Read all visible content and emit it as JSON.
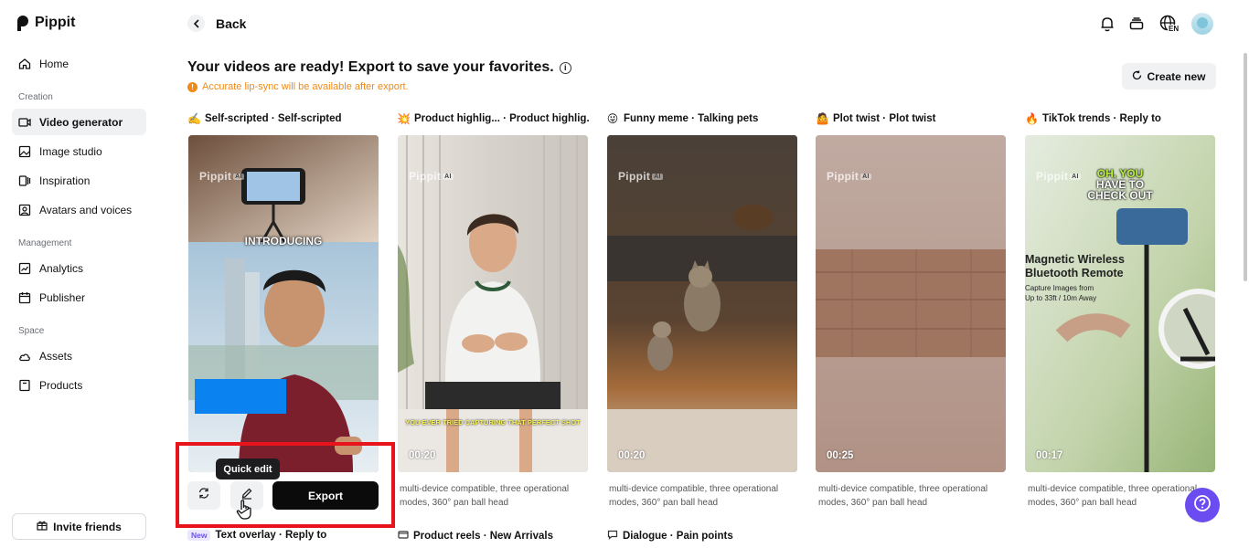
{
  "app": {
    "name": "Pippit"
  },
  "sidebar": {
    "home": "Home",
    "sections": [
      "Creation",
      "Management",
      "Space"
    ],
    "creation_items": [
      {
        "label": "Video generator",
        "icon": "video-generator-icon",
        "active": true
      },
      {
        "label": "Image studio",
        "icon": "image-studio-icon"
      },
      {
        "label": "Inspiration",
        "icon": "inspiration-icon"
      },
      {
        "label": "Avatars and voices",
        "icon": "avatar-voice-icon"
      }
    ],
    "management_items": [
      {
        "label": "Analytics",
        "icon": "analytics-icon"
      },
      {
        "label": "Publisher",
        "icon": "calendar-icon"
      }
    ],
    "space_items": [
      {
        "label": "Assets",
        "icon": "cloud-icon"
      },
      {
        "label": "Products",
        "icon": "product-box-icon"
      }
    ],
    "invite": "Invite friends"
  },
  "header": {
    "back": "Back",
    "language": "EN"
  },
  "main": {
    "headline": "Your videos are ready! Export to save your favorites.",
    "warning": "Accurate lip-sync will be available after export.",
    "create_new": "Create new",
    "cards": [
      {
        "emoji": "✍️",
        "title": "Self-scripted · Self-scripted",
        "watermark": "Pippit",
        "overlay": "INTRODUCING"
      },
      {
        "emoji": "💥",
        "title": "Product highlig... · Product highlig...",
        "watermark": "Pippit",
        "duration": "00:20",
        "subtitle": "YOU EVER TRIED CAPTURING THAT PERFECT SHOT",
        "desc": "multi-device compatible, three operational modes, 360° pan ball head"
      },
      {
        "emoji": "😜",
        "title": "Funny meme · Talking pets",
        "watermark": "Pippit",
        "duration": "00:20",
        "desc": "multi-device compatible, three operational modes, 360° pan ball head"
      },
      {
        "emoji": "🤷",
        "title": "Plot twist · Plot twist",
        "watermark": "Pippit",
        "duration": "00:25",
        "desc": "multi-device compatible, three operational modes, 360° pan ball head"
      },
      {
        "emoji": "🔥",
        "title": "TikTok trends · Reply to",
        "watermark": "Pippit",
        "duration": "00:17",
        "overlay_lines": [
          "OH, YOU",
          "HAVE TO",
          "CHECK OUT"
        ],
        "product_lines": [
          "Magnetic Wireless",
          "Bluetooth Remote",
          "Capture Images from",
          "Up to 33ft / 10m Away"
        ],
        "desc": "multi-device compatible, three operational modes, 360° pan ball head"
      }
    ],
    "bottom_cards": [
      {
        "badge": "New",
        "title": "Text overlay · Reply to"
      },
      {
        "icon": "product-reels-icon",
        "title": "Product reels · New Arrivals"
      },
      {
        "icon": "dialogue-icon",
        "title": "Dialogue · Pain points"
      }
    ],
    "actions": {
      "regenerate_icon": "refresh-icon",
      "edit_icon": "pencil-icon",
      "tooltip": "Quick edit",
      "export": "Export"
    }
  },
  "colors": {
    "accent": "#6b4cf0",
    "warning": "#f08a16",
    "highlight_box": "#e8141b",
    "export_bg": "#0b0b0b"
  }
}
